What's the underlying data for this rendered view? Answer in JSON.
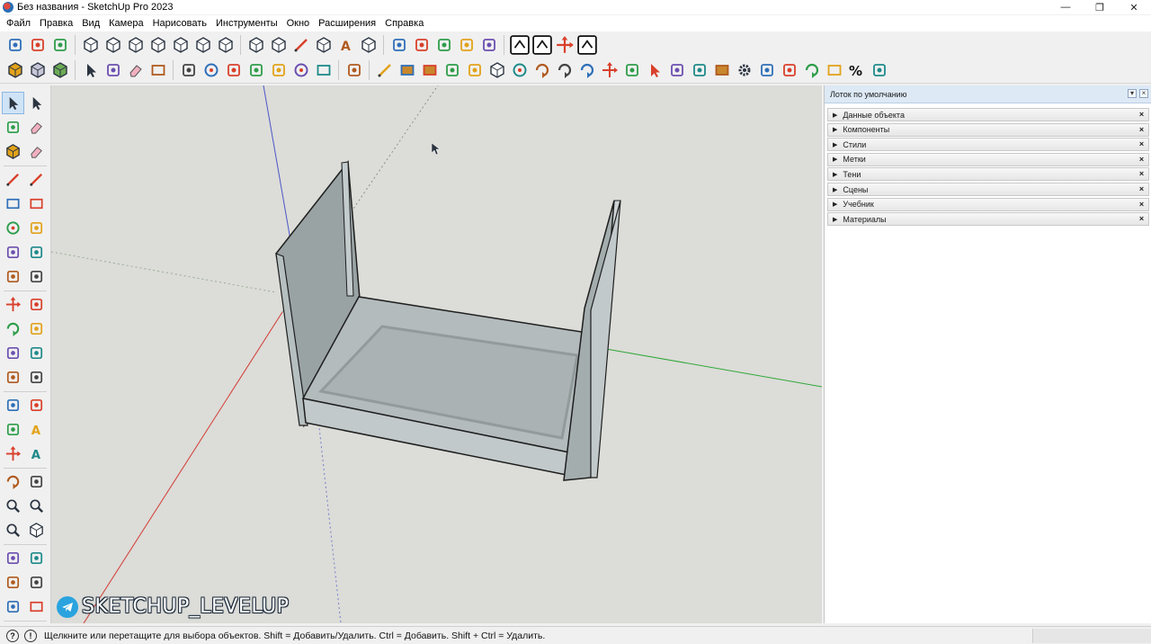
{
  "window": {
    "title": "Без названия - SketchUp Pro 2023",
    "controls": [
      "—",
      "❐",
      "✕"
    ]
  },
  "menu": [
    "Файл",
    "Правка",
    "Вид",
    "Камера",
    "Нарисовать",
    "Инструменты",
    "Окно",
    "Расширения",
    "Справка"
  ],
  "toolbar_top_icons": [
    "copy-along-path-icon",
    "paste-icon",
    "align-icon",
    "iso-view-icon",
    "top-view-icon",
    "front-view-icon",
    "right-view-icon",
    "back-view-icon",
    "left-view-icon",
    "bottom-view-icon",
    "xray-style-icon",
    "wireframe-style-icon",
    "hidden-line-style-icon",
    "shaded-style-icon",
    "textured-style-icon",
    "monochrome-style-icon",
    "section-plane-icon",
    "section-fill-icon",
    "section-cut-icon",
    "display-sections-icon",
    "layer-icon",
    "ocl-icon",
    "solid-inspector-icon",
    "axes-icon",
    "share-model-icon"
  ],
  "toolbar_second_icons": [
    "component-icon",
    "group-icon",
    "material-icon",
    "select-icon",
    "lasso-icon",
    "eraser-stamp-icon",
    "sandbox-icon",
    "drape-icon",
    "circle-target-icon",
    "angle-icon",
    "stamp-icon",
    "flip-icon",
    "dome-icon",
    "box-icon",
    "ruby-console-icon",
    "pencil-icon",
    "plank-icon",
    "board-icon",
    "post-icon",
    "stack-icon",
    "cube-icon",
    "rope-icon",
    "red-arrow-icon",
    "green-arrow-icon",
    "globe-arrow-icon",
    "axis-tripod-icon",
    "layer-stack-icon",
    "red-pointer-icon",
    "conveyor-icon",
    "drill-icon",
    "plank-tilt-icon",
    "gear-icon",
    "paint-figure-icon",
    "resize-icon",
    "swap-arrows-icon",
    "box-label-icon",
    "percent-icon",
    "speech-bubble-icon"
  ],
  "left_tools": [
    "select-icon",
    "lasso-select-icon",
    "paint-bucket-icon",
    "eraser-icon",
    "group-components-icon",
    "tag-eraser-icon",
    "line-icon",
    "freehand-icon",
    "rectangle-icon",
    "rotated-rectangle-icon",
    "circle-icon",
    "polygon-icon",
    "arc-icon",
    "two-point-arc-icon",
    "three-point-arc-icon",
    "pie-icon",
    "move-icon",
    "push-pull-icon",
    "rotate-icon",
    "follow-me-icon",
    "scale-icon",
    "offset-icon",
    "solid-tools-icon",
    "outer-shell-icon",
    "tape-measure-icon",
    "dimension-icon",
    "protractor-icon",
    "text-icon",
    "axes-icon",
    "3d-text-icon",
    "orbit-icon",
    "pan-icon",
    "zoom-icon",
    "zoom-window-icon",
    "zoom-extents-icon",
    "previous-view-icon",
    "position-camera-icon",
    "walk-icon",
    "look-around-icon",
    "section-plane-icon",
    "extension-warehouse-icon",
    "sandbox-tools-icon"
  ],
  "watermark": {
    "text": "SKETCHUP_LEVELUP"
  },
  "tray": {
    "title": "Лоток по умолчанию",
    "sections": [
      "Данные объекта",
      "Компоненты",
      "Стили",
      "Метки",
      "Тени",
      "Сцены",
      "Учебник",
      "Материалы"
    ]
  },
  "status": {
    "text": "Щелкните или перетащите для выбора объектов. Shift = Добавить/Удалить. Ctrl = Добавить. Shift + Ctrl = Удалить."
  },
  "colors": {
    "viewport_bg": "#dcdcd8",
    "model_face": "#a7b0b1",
    "model_face_dark": "#8d9596",
    "axis_red": "#d23a33",
    "axis_green": "#2fa83a",
    "axis_blue": "#4b55c8"
  }
}
